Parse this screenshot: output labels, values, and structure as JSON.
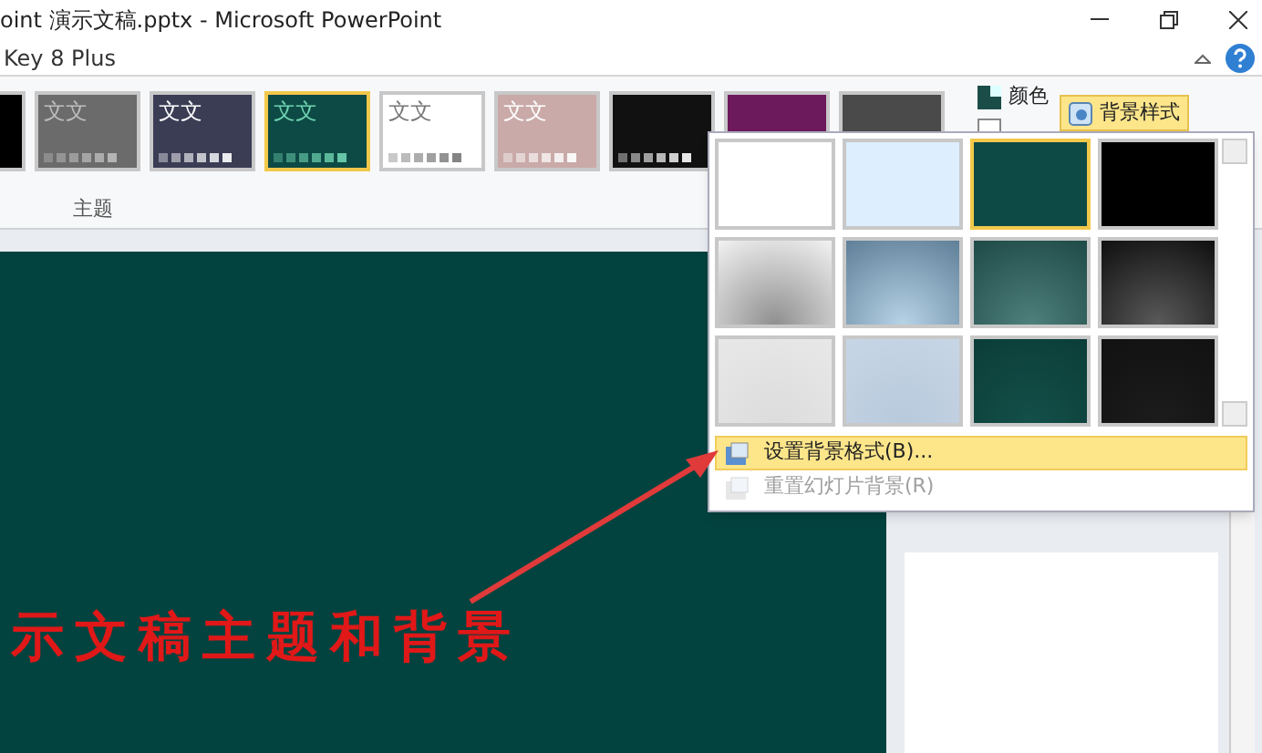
{
  "window": {
    "title": "oint 演示文稿.pptx - Microsoft PowerPoint"
  },
  "tab_row": {
    "text": "Key 8 Plus"
  },
  "themes": {
    "label": "主题",
    "items": [
      {
        "kind": "cut",
        "selected": false
      },
      {
        "kind": "full",
        "label": "文文",
        "selected": false
      },
      {
        "kind": "full",
        "label": "文文",
        "selected": false
      },
      {
        "kind": "full",
        "label": "文文",
        "selected": true
      },
      {
        "kind": "full",
        "label": "文文",
        "selected": false
      },
      {
        "kind": "full",
        "label": "文文",
        "selected": false
      },
      {
        "kind": "full",
        "selected": false
      },
      {
        "kind": "full",
        "selected": false
      },
      {
        "kind": "full",
        "selected": false
      }
    ]
  },
  "theme_options": [
    {
      "label": "颜色",
      "kind": "colors"
    },
    {
      "kind": "fonts"
    }
  ],
  "background_styles_button": {
    "label": "背景样式",
    "selected": true
  },
  "background_menu": {
    "styles": [
      {
        "selected": false
      },
      {
        "selected": false
      },
      {
        "selected": true
      },
      {
        "selected": false
      },
      {
        "selected": false
      },
      {
        "selected": false
      },
      {
        "selected": false
      },
      {
        "selected": false
      },
      {
        "selected": false
      },
      {
        "selected": false
      },
      {
        "selected": false
      },
      {
        "selected": false
      }
    ],
    "items": [
      {
        "label": "设置背景格式(B)...",
        "selected": true,
        "disabled": false
      },
      {
        "label": "重置幻灯片背景(R)",
        "selected": false,
        "disabled": true
      }
    ]
  },
  "slide": {
    "title": "示文稿主题和背景"
  }
}
